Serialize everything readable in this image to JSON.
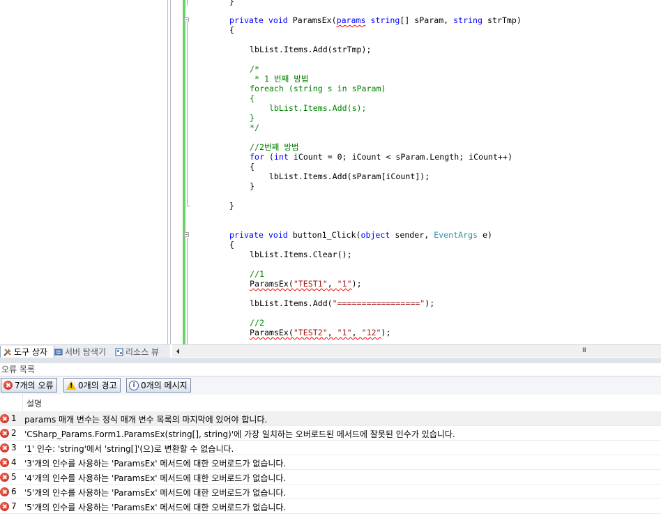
{
  "editor": {
    "lines": [
      [
        {
          "t": "}"
        }
      ],
      [
        {
          "t": "private",
          "c": "kw"
        },
        {
          "t": " "
        },
        {
          "t": "void",
          "c": "kw"
        },
        {
          "t": " ParamsEx("
        },
        {
          "t": "params",
          "c": "kw sq"
        },
        {
          "t": " "
        },
        {
          "t": "string",
          "c": "kw"
        },
        {
          "t": "[] sParam, "
        },
        {
          "t": "string",
          "c": "kw"
        },
        {
          "t": " strTmp)"
        }
      ],
      [
        {
          "t": "{"
        }
      ],
      [
        {
          "t": "lbList.Items.Add(strTmp);"
        }
      ],
      [
        {
          "t": "/*",
          "c": "cm"
        }
      ],
      [
        {
          "t": " * 1 번째 방법",
          "c": "cm"
        }
      ],
      [
        {
          "t": "foreach (string s in sParam)",
          "c": "cm"
        }
      ],
      [
        {
          "t": "{",
          "c": "cm"
        }
      ],
      [
        {
          "t": "    lbList.Items.Add(s);",
          "c": "cm"
        }
      ],
      [
        {
          "t": "}",
          "c": "cm"
        }
      ],
      [
        {
          "t": "*/",
          "c": "cm"
        }
      ],
      [
        {
          "t": "//2번째 방법",
          "c": "cm"
        }
      ],
      [
        {
          "t": "for",
          "c": "kw"
        },
        {
          "t": " ("
        },
        {
          "t": "int",
          "c": "kw"
        },
        {
          "t": " iCount = 0; iCount < sParam.Length; iCount++)"
        }
      ],
      [
        {
          "t": "{"
        }
      ],
      [
        {
          "t": "    lbList.Items.Add(sParam[iCount]);"
        }
      ],
      [
        {
          "t": "}"
        }
      ],
      [
        {
          "t": "}"
        }
      ],
      [
        {
          "t": "private",
          "c": "kw"
        },
        {
          "t": " "
        },
        {
          "t": "void",
          "c": "kw"
        },
        {
          "t": " button1_Click("
        },
        {
          "t": "object",
          "c": "kw"
        },
        {
          "t": " sender, "
        },
        {
          "t": "EventArgs",
          "c": "ty"
        },
        {
          "t": " e)"
        }
      ],
      [
        {
          "t": "{"
        }
      ],
      [
        {
          "t": "lbList.Items.Clear();"
        }
      ],
      [
        {
          "t": "//1",
          "c": "cm"
        }
      ],
      [
        {
          "t": "ParamsEx(",
          "c": "sq"
        },
        {
          "t": "\"TEST1\"",
          "c": "st sq"
        },
        {
          "t": ", ",
          "c": "sq"
        },
        {
          "t": "\"1\"",
          "c": "st sq"
        },
        {
          "t": ");"
        }
      ],
      [
        {
          "t": "lbList.Items.Add("
        },
        {
          "t": "\"=================\"",
          "c": "st"
        },
        {
          "t": ");"
        }
      ],
      [
        {
          "t": "//2",
          "c": "cm"
        }
      ],
      [
        {
          "t": "ParamsEx(",
          "c": "sq"
        },
        {
          "t": "\"TEST2\"",
          "c": "st sq"
        },
        {
          "t": ", ",
          "c": "sq"
        },
        {
          "t": "\"1\"",
          "c": "st sq"
        },
        {
          "t": ", ",
          "c": "sq"
        },
        {
          "t": "\"12\"",
          "c": "st sq"
        },
        {
          "t": ");"
        }
      ]
    ],
    "scroll_grip": "III"
  },
  "bottom_tabs": {
    "toolbox": "도구 상자",
    "server_explorer": "서버 탐색기",
    "resource_view": "리소스 뷰"
  },
  "error_list": {
    "title": "오류 목록",
    "filters": {
      "errors": "7개의 오류",
      "warnings": "0개의 경고",
      "messages": "0개의 메시지"
    },
    "column_description": "설명",
    "rows": [
      {
        "num": "1",
        "desc": "params 매개 변수는 정식 매개 변수 목록의 마지막에 있어야 합니다."
      },
      {
        "num": "2",
        "desc": "'CSharp_Params.Form1.ParamsEx(string[], string)'에 가장 일치하는 오버로드된 메서드에 잘못된 인수가 있습니다."
      },
      {
        "num": "3",
        "desc": "'1' 인수: 'string'에서 'string[]'(으)로 변환할 수 없습니다."
      },
      {
        "num": "4",
        "desc": "'3'개의 인수를 사용하는 'ParamsEx' 메서드에 대한 오버로드가 없습니다."
      },
      {
        "num": "5",
        "desc": "'4'개의 인수를 사용하는 'ParamsEx' 메서드에 대한 오버로드가 없습니다."
      },
      {
        "num": "6",
        "desc": "'5'개의 인수를 사용하는 'ParamsEx' 메서드에 대한 오버로드가 없습니다."
      },
      {
        "num": "7",
        "desc": "'5'개의 인수를 사용하는 'ParamsEx' 메서드에 대한 오버로드가 없습니다."
      }
    ]
  }
}
